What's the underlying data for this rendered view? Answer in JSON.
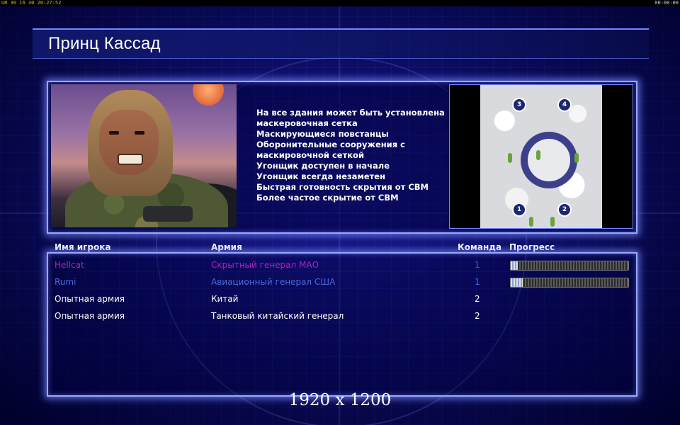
{
  "status_bar": {
    "left": "UR 30 16 30 20:27:52",
    "right": "00:00:00"
  },
  "title": "Принц Кассад",
  "general": {
    "features": [
      "На все здания может быть установлена",
      " маскеровочная сетка",
      "Маскирующиеся повстанцы",
      "Оборонительные сооружения с",
      " маскировочной сеткой",
      "Угонщик доступен в начале",
      "Угонщик всегда незаметен",
      "Быстрая готовность скрытия от СВМ",
      "Более частое скрытие от СВМ"
    ]
  },
  "minimap": {
    "start_positions": [
      "3",
      "4",
      "1",
      "2"
    ]
  },
  "table": {
    "headers": {
      "name": "Имя игрока",
      "army": "Армия",
      "team": "Команда",
      "progress": "Прогресс"
    },
    "rows": [
      {
        "name": "Hellcat",
        "army": "Скрытный генерал МАО",
        "team": "1",
        "color": "#b020c8",
        "progress": 0.06
      },
      {
        "name": "Rumi",
        "army": "Авиационный генерал США",
        "team": "1",
        "color": "#4a6ad8",
        "progress": 0.1
      },
      {
        "name": "Опытная армия",
        "army": "Китай",
        "team": "2",
        "color": "#ffffff",
        "progress": null
      },
      {
        "name": "Опытная армия",
        "army": "Танковый китайский генерал",
        "team": "2",
        "color": "#ffffff",
        "progress": null
      }
    ]
  },
  "resolution_label": "1920 x 1200",
  "colors": {
    "panel_border": "#9aa8ff",
    "background": "#05054a"
  }
}
